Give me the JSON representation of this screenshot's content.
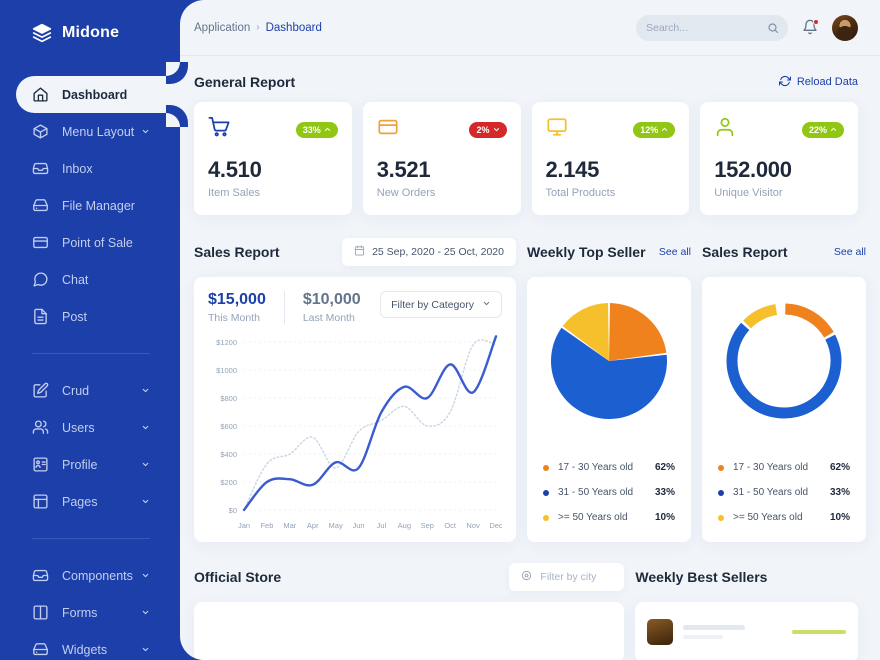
{
  "brand": {
    "name": "Midone",
    "icon": "layers-icon"
  },
  "sidebar": {
    "groups": [
      {
        "items": [
          {
            "label": "Dashboard",
            "icon": "home-icon",
            "active": true,
            "chevron": false
          },
          {
            "label": "Menu Layout",
            "icon": "box-icon",
            "active": false,
            "chevron": true
          },
          {
            "label": "Inbox",
            "icon": "inbox-icon",
            "active": false,
            "chevron": false
          },
          {
            "label": "File Manager",
            "icon": "hard-drive-icon",
            "active": false,
            "chevron": false
          },
          {
            "label": "Point of Sale",
            "icon": "credit-card-icon",
            "active": false,
            "chevron": false
          },
          {
            "label": "Chat",
            "icon": "message-icon",
            "active": false,
            "chevron": false
          },
          {
            "label": "Post",
            "icon": "file-text-icon",
            "active": false,
            "chevron": false
          }
        ]
      },
      {
        "items": [
          {
            "label": "Crud",
            "icon": "edit-square-icon",
            "active": false,
            "chevron": true
          },
          {
            "label": "Users",
            "icon": "users-icon",
            "active": false,
            "chevron": true
          },
          {
            "label": "Profile",
            "icon": "profile-card-icon",
            "active": false,
            "chevron": true
          },
          {
            "label": "Pages",
            "icon": "layout-icon",
            "active": false,
            "chevron": true
          }
        ]
      },
      {
        "items": [
          {
            "label": "Components",
            "icon": "inbox-icon",
            "active": false,
            "chevron": true
          },
          {
            "label": "Forms",
            "icon": "columns-icon",
            "active": false,
            "chevron": true
          },
          {
            "label": "Widgets",
            "icon": "hard-drive-icon",
            "active": false,
            "chevron": true
          }
        ]
      }
    ]
  },
  "topbar": {
    "breadcrumb_root": "Application",
    "breadcrumb_sep": "›",
    "breadcrumb_current": "Dashboard",
    "search_placeholder": "Search...",
    "search_value": "",
    "notification_dot": true
  },
  "general_report": {
    "title": "General Report",
    "reload_label": "Reload Data",
    "cards": [
      {
        "icon": "shopping-cart-icon",
        "icon_color": "#1C3FAA",
        "badge": "33%",
        "badge_dir": "up",
        "value": "4.510",
        "label": "Item Sales"
      },
      {
        "icon": "credit-card-icon",
        "icon_color": "#F0A13C",
        "badge": "2%",
        "badge_dir": "down",
        "value": "3.521",
        "label": "New Orders"
      },
      {
        "icon": "monitor-icon",
        "icon_color": "#F5C02B",
        "badge": "12%",
        "badge_dir": "up",
        "value": "2.145",
        "label": "Total Products"
      },
      {
        "icon": "user-icon",
        "icon_color": "#91C714",
        "badge": "22%",
        "badge_dir": "up",
        "value": "152.000",
        "label": "Unique Visitor"
      }
    ]
  },
  "sales_report": {
    "title": "Sales Report",
    "date_range": "25 Sep, 2020 - 25 Oct, 2020",
    "this_month_value": "$15,000",
    "this_month_label": "This Month",
    "last_month_value": "$10,000",
    "last_month_label": "Last Month",
    "filter_label": "Filter by Category"
  },
  "weekly_top_seller": {
    "title": "Weekly Top Seller",
    "see_all": "See all"
  },
  "sales_report_donut": {
    "title": "Sales Report",
    "see_all": "See all"
  },
  "age_legend": [
    {
      "label": "17 - 30 Years old",
      "pct": "62%",
      "color": "#F0821E"
    },
    {
      "label": "31 - 50 Years old",
      "pct": "33%",
      "color": "#1C3FAA"
    },
    {
      "label": ">= 50 Years old",
      "pct": "10%",
      "color": "#F5C02B"
    }
  ],
  "official_store": {
    "title": "Official Store",
    "city_placeholder": "Filter by city",
    "city_value": ""
  },
  "weekly_best_sellers": {
    "title": "Weekly Best Sellers"
  },
  "chart_data": [
    {
      "type": "line",
      "title": "Sales Report",
      "xlabel": "",
      "ylabel": "",
      "ylim": [
        0,
        1200
      ],
      "ytick_labels": [
        "$0",
        "$200",
        "$400",
        "$600",
        "$800",
        "$1000",
        "$1200"
      ],
      "ytick_values": [
        0,
        200,
        400,
        600,
        800,
        1000,
        1200
      ],
      "categories": [
        "Jan",
        "Feb",
        "Mar",
        "Apr",
        "May",
        "Jun",
        "Jul",
        "Aug",
        "Sep",
        "Oct",
        "Nov",
        "Dec"
      ],
      "grid": true,
      "legend": "none",
      "series": [
        {
          "name": "This Month",
          "color": "#3B5BD0",
          "style": "solid",
          "values": [
            0,
            200,
            220,
            180,
            340,
            300,
            700,
            880,
            800,
            1040,
            840,
            1240
          ]
        },
        {
          "name": "Last Month",
          "color": "#CBD5E1",
          "style": "dotted",
          "values": [
            0,
            330,
            400,
            520,
            300,
            560,
            640,
            740,
            600,
            700,
            1180,
            1180
          ]
        }
      ]
    },
    {
      "type": "pie",
      "title": "Weekly Top Seller",
      "labels": [
        "17 - 30 Years old",
        "31 - 50 Years old",
        ">= 50 Years old"
      ],
      "legend_values": [
        62,
        33,
        10
      ],
      "slice_fractions": [
        0.23,
        0.62,
        0.15
      ],
      "colors": [
        "#F0821E",
        "#1C5FD0",
        "#F5C02B"
      ],
      "legend_position": "bottom"
    },
    {
      "type": "pie",
      "variant": "donut",
      "title": "Sales Report",
      "labels": [
        "17 - 30 Years old",
        "31 - 50 Years old",
        ">= 50 Years old"
      ],
      "legend_values": [
        62,
        33,
        10
      ],
      "slice_fractions": [
        0.17,
        0.7,
        0.11
      ],
      "colors": [
        "#F0821E",
        "#1C5FD0",
        "#F5C02B"
      ],
      "legend_position": "bottom"
    }
  ]
}
